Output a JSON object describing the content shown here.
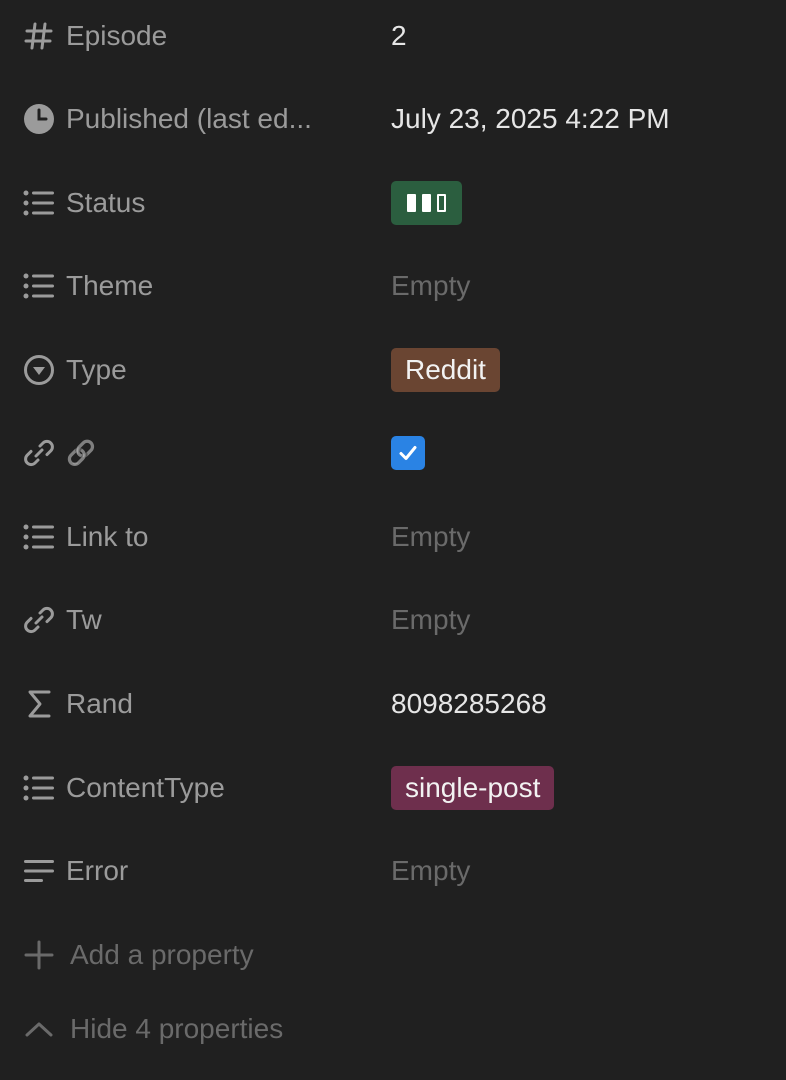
{
  "properties": [
    {
      "icon": "hash-icon",
      "label": "Episode",
      "value": "2",
      "kind": "text"
    },
    {
      "icon": "clock-icon",
      "label": "Published (last ed...",
      "value": "July 23, 2025 4:22 PM",
      "kind": "text"
    },
    {
      "icon": "list-icon",
      "label": "Status",
      "value": "▮▮▯",
      "kind": "tag",
      "tag_color": "#2b5e3f"
    },
    {
      "icon": "list-icon",
      "label": "Theme",
      "value": "Empty",
      "kind": "empty"
    },
    {
      "icon": "select-icon",
      "label": "Type",
      "value": "Reddit",
      "kind": "tag",
      "tag_color": "#6a4532"
    },
    {
      "icon": "link-icon",
      "label": "🔗",
      "value": true,
      "kind": "checkbox",
      "checkbox_color": "#2a83e4"
    },
    {
      "icon": "list-icon",
      "label": "Link to",
      "value": "Empty",
      "kind": "empty"
    },
    {
      "icon": "link-icon",
      "label": "Tw",
      "value": "Empty",
      "kind": "empty"
    },
    {
      "icon": "sigma-icon",
      "label": "Rand",
      "value": "8098285268",
      "kind": "text"
    },
    {
      "icon": "list-icon",
      "label": "ContentType",
      "value": "single-post",
      "kind": "tag",
      "tag_color": "#6e2f4d"
    },
    {
      "icon": "text-icon",
      "label": "Error",
      "value": "Empty",
      "kind": "empty"
    }
  ],
  "footer": {
    "add_property": "Add a property",
    "hide_properties": "Hide 4 properties"
  },
  "colors": {
    "background": "#202020",
    "label": "#9b9b9b",
    "value": "#e6e6e6",
    "empty": "#6a6a6a"
  }
}
